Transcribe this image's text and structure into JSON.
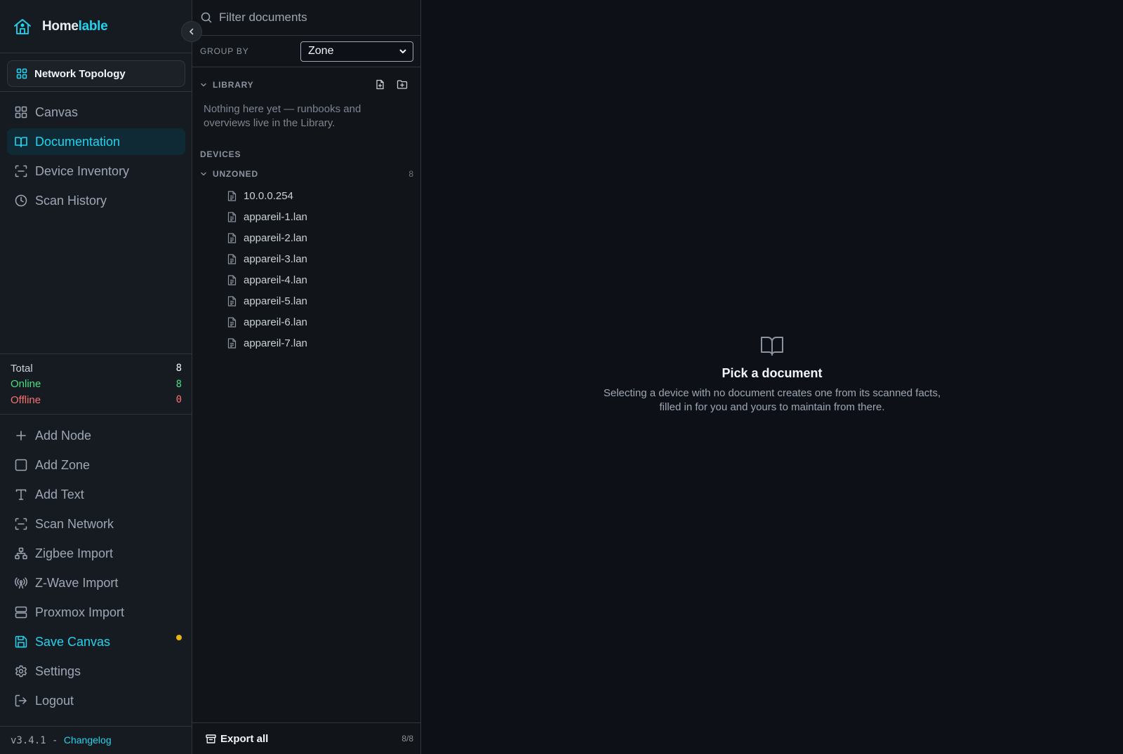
{
  "brand": {
    "name_part1": "Home",
    "name_part2": "lable"
  },
  "canvas_selector": {
    "label": "Network Topology"
  },
  "nav": {
    "canvas": "Canvas",
    "documentation": "Documentation",
    "device_inventory": "Device Inventory",
    "scan_history": "Scan History"
  },
  "stats": {
    "total_label": "Total",
    "total_value": "8",
    "online_label": "Online",
    "online_value": "8",
    "offline_label": "Offline",
    "offline_value": "0"
  },
  "actions": {
    "add_node": "Add Node",
    "add_zone": "Add Zone",
    "add_text": "Add Text",
    "scan_network": "Scan Network",
    "zigbee_import": "Zigbee Import",
    "zwave_import": "Z-Wave Import",
    "proxmox_import": "Proxmox Import",
    "save_canvas": "Save Canvas",
    "settings": "Settings",
    "logout": "Logout"
  },
  "footer": {
    "version": "v3.4.1",
    "separator": " - ",
    "changelog": "Changelog"
  },
  "docs": {
    "filter_placeholder": "Filter documents",
    "group_by_label": "GROUP BY",
    "group_by_value": "Zone",
    "library_label": "LIBRARY",
    "library_empty": "Nothing here yet — runbooks and overviews live in the Library.",
    "devices_label": "DEVICES",
    "unzoned_label": "UNZONED",
    "unzoned_count": "8",
    "items": [
      "10.0.0.254",
      "appareil-1.lan",
      "appareil-2.lan",
      "appareil-3.lan",
      "appareil-4.lan",
      "appareil-5.lan",
      "appareil-6.lan",
      "appareil-7.lan"
    ],
    "export_label": "Export all",
    "export_ratio": "8/8"
  },
  "empty_state": {
    "title": "Pick a document",
    "description": "Selecting a device with no document creates one from its scanned facts, filled in for you and yours to maintain from there."
  },
  "colors": {
    "accent": "#22d3ee",
    "online": "#4ade80",
    "offline": "#f87171",
    "unsaved": "#eab308",
    "background": "#0d1117",
    "sidebar": "#161b22"
  }
}
